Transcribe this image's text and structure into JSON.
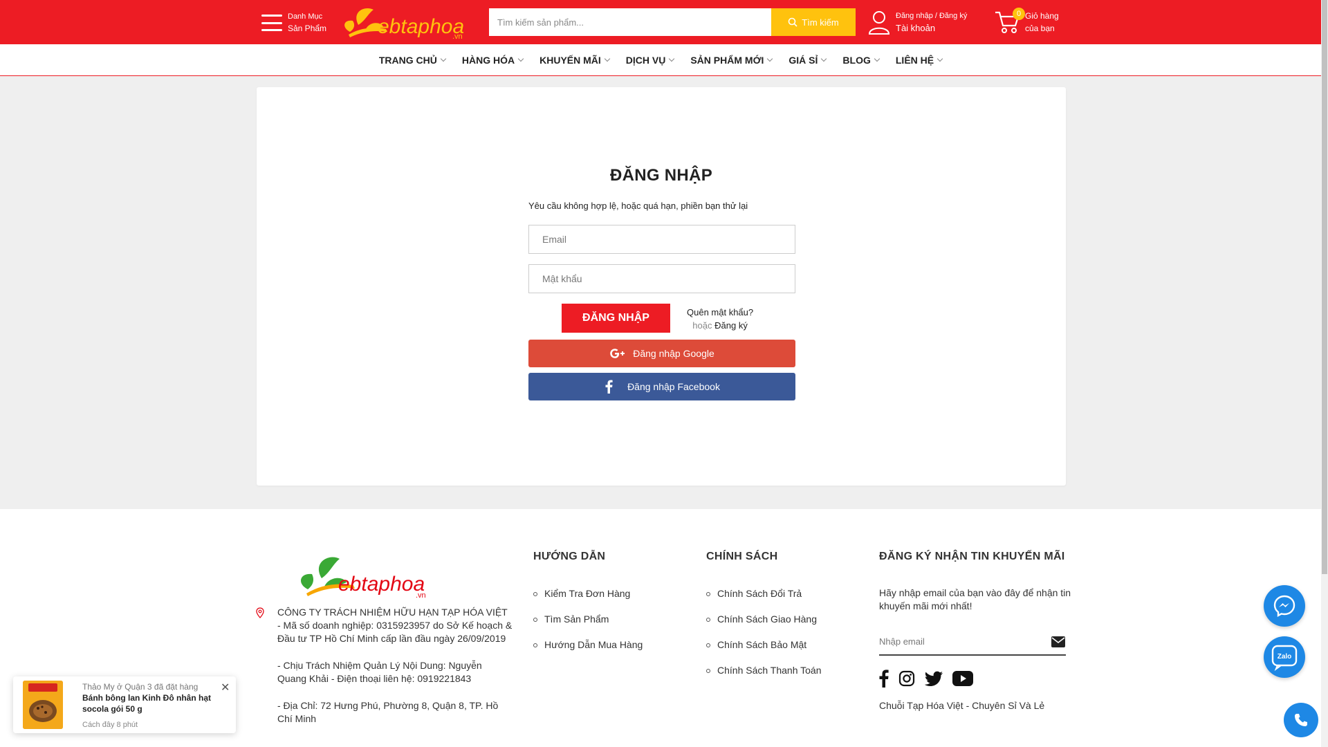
{
  "header": {
    "menu_line1": "Danh Mục",
    "menu_line2": "Sản Phẩm",
    "logo_text": "ebtaphoa",
    "logo_suffix": ".vn",
    "search_placeholder": "Tìm kiếm sản phẩm...",
    "search_button": "Tìm kiếm",
    "account_line1": "Đăng nhập / Đăng ký",
    "account_line2": "Tài khoản",
    "cart_count": "0",
    "cart_line1": "Giỏ hàng",
    "cart_line2": "của bạn"
  },
  "nav": {
    "items": [
      "TRANG CHỦ",
      "HÀNG HÓA",
      "KHUYẾN MÃI",
      "DỊCH VỤ",
      "SẢN PHẨM MỚI",
      "GIÁ SỈ",
      "BLOG",
      "LIÊN HỆ"
    ]
  },
  "login": {
    "title": "ĐĂNG NHẬP",
    "message": "Yêu cầu không hợp lệ, hoặc quá hạn, phiền bạn thử lại",
    "email_placeholder": "Email",
    "password_placeholder": "Mật khẩu",
    "submit": "ĐĂNG NHẬP",
    "forgot": "Quên mật khẩu?",
    "or": "hoặc",
    "register": "Đăng ký",
    "google": "Đăng nhập Google",
    "facebook": "Đăng nhập Facebook"
  },
  "footer": {
    "company": "CÔNG TY TRÁCH NHIỆM HỮU HẠN TẠP HÓA VIỆT - Mã số doanh nghiệp: 0315923957 do Sở Kế hoạch & Đầu tư TP Hồ Chí Minh cấp lần đầu ngày 26/09/2019",
    "manager": "- Chịu Trách Nhiệm Quản Lý Nội Dung: Nguyễn Quang Khải - Điện thoại liên hệ: 0919221843",
    "address": "- Địa Chỉ: 72 Hưng Phú, Phường 8, Quận 8, TP. Hồ Chí Minh",
    "guide_title": "HƯỚNG DẪN",
    "guide_items": [
      "Kiểm Tra Đơn Hàng",
      "Tìm Sản Phẩm",
      "Hướng Dẫn Mua Hàng"
    ],
    "policy_title": "CHÍNH SÁCH",
    "policy_items": [
      "Chính Sách Đổi Trả",
      "Chính Sách Giao Hàng",
      "Chính Sách Bảo Mật",
      "Chính Sách Thanh Toán"
    ],
    "news_title": "ĐĂNG KÝ NHẬN TIN KHUYẾN MÃI",
    "news_text": "Hãy nhập email của bạn vào đây để nhận tin khuyến mãi mới nhất!",
    "news_placeholder": "Nhập email",
    "tagline": "Chuỗi Tạp Hóa Việt - Chuyên Sỉ Và Lẻ"
  },
  "widgets": {
    "zalo_label": "Zalo"
  },
  "toast": {
    "who": "Thảo My ở Quận 3 đã đặt hàng",
    "product": "Bánh bông lan Kinh Đô nhân hạt socola gói 50 g",
    "time": "Cách đây 8 phút"
  },
  "colors": {
    "brand_red": "#ed1c24",
    "accent_yellow": "#ffc20e",
    "google_red": "#dd4b39",
    "facebook_blue": "#3b5998",
    "widget_blue": "#1e88e5"
  }
}
